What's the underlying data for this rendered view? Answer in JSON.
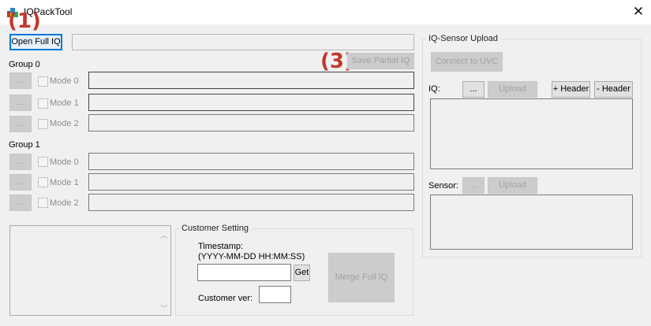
{
  "window": {
    "title": "IQPackTool",
    "close_glyph": "✕"
  },
  "annotations": {
    "one": "(1)",
    "three": "(3)"
  },
  "toolbar": {
    "open_full_iq": "Open Full IQ",
    "save_partial_iq": "Save Partial IQ"
  },
  "groups": [
    {
      "title": "Group 0",
      "modes": [
        {
          "browse": "...",
          "label": "Mode 0"
        },
        {
          "browse": "...",
          "label": "Mode 1"
        },
        {
          "browse": "...",
          "label": "Mode 2"
        }
      ]
    },
    {
      "title": "Group 1",
      "modes": [
        {
          "browse": "...",
          "label": "Mode 0"
        },
        {
          "browse": "...",
          "label": "Mode 1"
        },
        {
          "browse": "...",
          "label": "Mode 2"
        }
      ]
    }
  ],
  "customer": {
    "group_title": "Customer Setting",
    "timestamp_label": "Timestamp:",
    "timestamp_format": "(YYYY-MM-DD HH:MM:SS)",
    "get_button": "Get",
    "ver_label": "Customer ver:",
    "merge_button": "Merge Full IQ"
  },
  "sensor_upload": {
    "group_title": "IQ-Sensor Upload",
    "connect_button": "Connect to UVC",
    "iq_label": "IQ:",
    "iq_browse": "...",
    "iq_upload": "Upload",
    "add_header": "+ Header",
    "remove_header": "- Header",
    "sensor_label": "Sensor:",
    "sensor_browse": "...",
    "sensor_upload": "Upload"
  },
  "scroll": {
    "up": "︿",
    "down": "﹀"
  }
}
